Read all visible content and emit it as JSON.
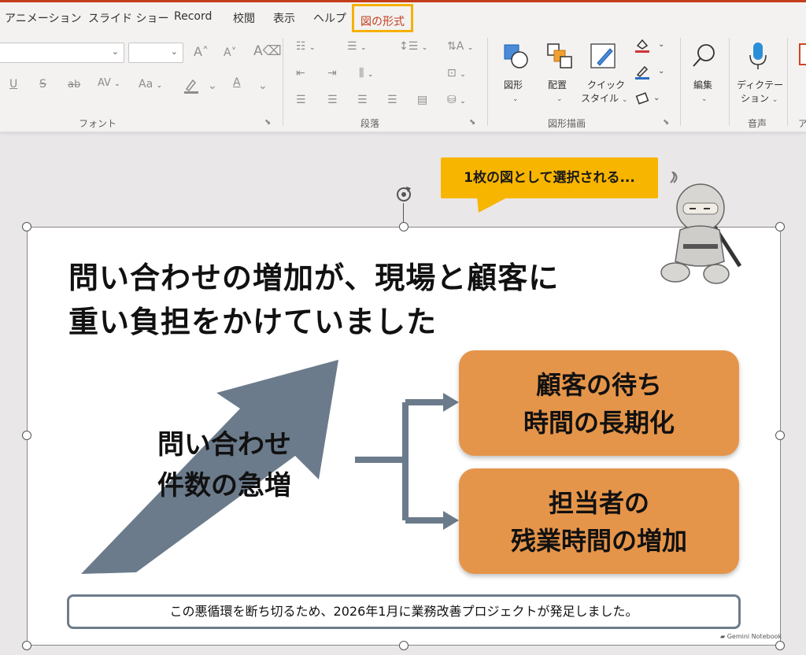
{
  "tabs": {
    "animation": "アニメーション",
    "slideshow": "スライド ショー",
    "record": "Record",
    "review": "校閲",
    "view": "表示",
    "help": "ヘルプ",
    "picture_format": "図の形式"
  },
  "ribbon": {
    "font_group": "フォント",
    "paragraph_group": "段落",
    "drawing_group": "図形描画",
    "voice_group": "音声",
    "partial_group": "ア",
    "shapes_label": "図形",
    "arrange_label": "配置",
    "quick_style_label_1": "クイック",
    "quick_style_label_2": "スタイル",
    "edit_label": "編集",
    "dictate_label_1": "ディクテー",
    "dictate_label_2": "ション",
    "grow_font": "A",
    "shrink_font": "A",
    "clear_format": "A",
    "underline": "U",
    "strike_s": "S",
    "strike_ab": "ab",
    "spacing": "AV",
    "case": "Aa",
    "font_color": "A"
  },
  "callout": {
    "text": "1枚の図として選択される..."
  },
  "slide": {
    "title_line1": "問い合わせの増加が、現場と顧客に",
    "title_line2": "重い負担をかけていました",
    "arrow_label_line1": "問い合わせ",
    "arrow_label_line2": "件数の急増",
    "box1_line1": "顧客の待ち",
    "box1_line2": "時間の長期化",
    "box2_line1": "担当者の",
    "box2_line2": "残業時間の増加",
    "footer": "この悪循環を断ち切るため、2026年1月に業務改善プロジェクトが発足しました。",
    "watermark": "Gemini Notebook"
  },
  "colors": {
    "accent": "#c43e1c",
    "highlight": "#f6b000",
    "callout": "#f7b500",
    "arrow": "#6b7b8b",
    "box": "#e5954a"
  },
  "icons": [
    "search-icon",
    "microphone-icon",
    "shapes-icon",
    "arrange-icon",
    "quick-style-icon",
    "rotate-icon",
    "dialog-launcher-icon"
  ]
}
